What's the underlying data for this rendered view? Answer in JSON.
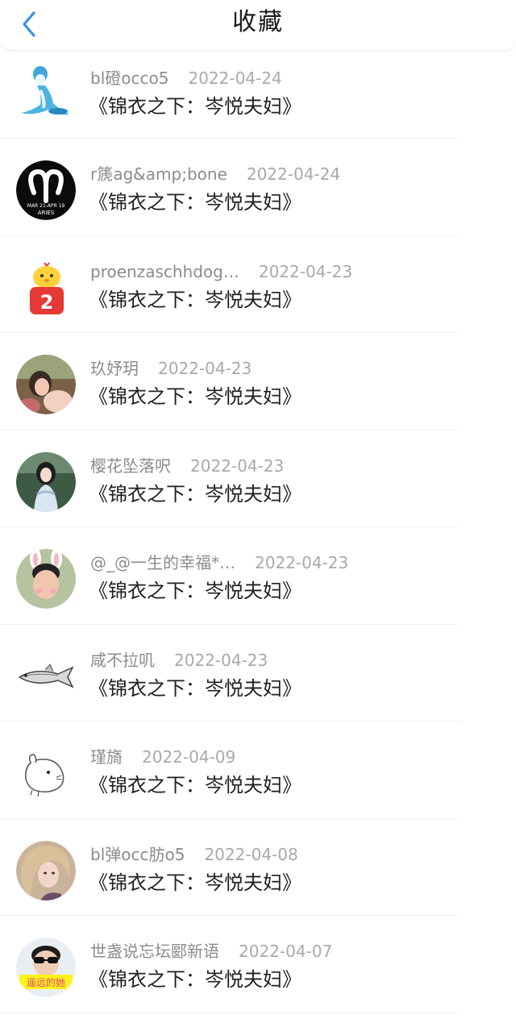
{
  "header": {
    "title": "收藏",
    "accent": "#3b8ee6"
  },
  "items": [
    {
      "user": "bl磴occo5",
      "date": "2022-04-24",
      "title": "《锦衣之下：岑悦夫妇》"
    },
    {
      "user": "r篪ag&amp;bone",
      "date": "2022-04-24",
      "title": "《锦衣之下：岑悦夫妇》"
    },
    {
      "user": "proenzaschhdog…",
      "date": "2022-04-23",
      "title": "《锦衣之下：岑悦夫妇》",
      "avatar_badge": "2"
    },
    {
      "user": "玖妤玥",
      "date": "2022-04-23",
      "title": "《锦衣之下：岑悦夫妇》"
    },
    {
      "user": "樱花坠落呎",
      "date": "2022-04-23",
      "title": "《锦衣之下：岑悦夫妇》"
    },
    {
      "user": "@_@一生的幸福*…",
      "date": "2022-04-23",
      "title": "《锦衣之下：岑悦夫妇》"
    },
    {
      "user": "咸不拉叽",
      "date": "2022-04-23",
      "title": "《锦衣之下：岑悦夫妇》"
    },
    {
      "user": "瑾旖",
      "date": "2022-04-09",
      "title": "《锦衣之下：岑悦夫妇》"
    },
    {
      "user": "bl弹occ肪o5",
      "date": "2022-04-08",
      "title": "《锦衣之下：岑悦夫妇》"
    },
    {
      "user": "世盏说忘坛郾新语",
      "date": "2022-04-07",
      "title": "《锦衣之下：岑悦夫妇》",
      "avatar_caption": "遥远的她"
    }
  ],
  "avatars": [
    "blue-pokemon-avatar",
    "aries-zodiac-avatar",
    "cartoon-chick-avatar",
    "girl-photo-avatar",
    "girl-hanfu-avatar",
    "bunny-ears-photo-avatar",
    "fish-sketch-avatar",
    "hamster-sketch-avatar",
    "girl-photo-avatar",
    "sunglasses-boy-avatar"
  ],
  "aries_avatar_text": {
    "line1": "MAR 21-APR 19",
    "line2": "ARIES"
  }
}
